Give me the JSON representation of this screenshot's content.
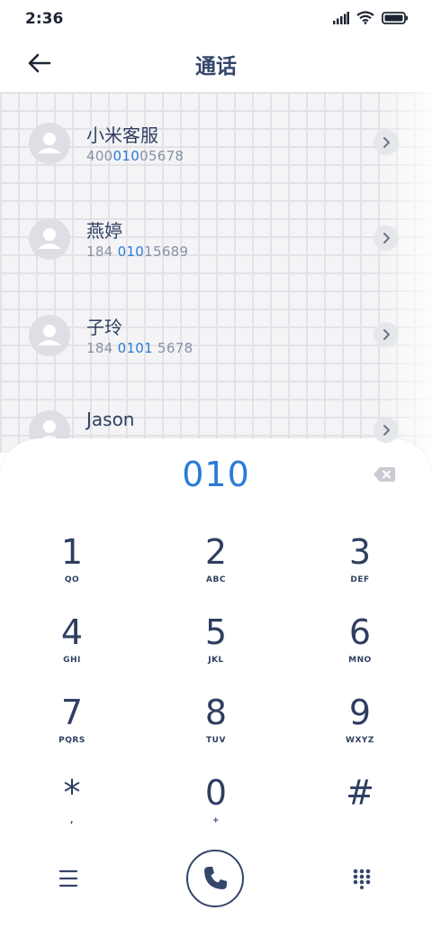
{
  "status_bar": {
    "time": "2:36"
  },
  "header": {
    "title": "通话"
  },
  "contacts": [
    {
      "name": "小米客服",
      "number_parts": [
        "400",
        "010",
        "05678"
      ]
    },
    {
      "name": "燕婷",
      "number_parts": [
        "184 ",
        "010",
        "15689"
      ]
    },
    {
      "name": "子玲",
      "number_parts": [
        "184 ",
        "0101",
        " 5678"
      ]
    },
    {
      "name": "Jason",
      "number_parts": [
        "",
        "",
        ""
      ]
    }
  ],
  "dialer": {
    "input": "010",
    "keys": [
      {
        "digit": "1",
        "letters": "QO"
      },
      {
        "digit": "2",
        "letters": "ABC"
      },
      {
        "digit": "3",
        "letters": "DEF"
      },
      {
        "digit": "4",
        "letters": "GHI"
      },
      {
        "digit": "5",
        "letters": "JKL"
      },
      {
        "digit": "6",
        "letters": "MNO"
      },
      {
        "digit": "7",
        "letters": "PQRS"
      },
      {
        "digit": "8",
        "letters": "TUV"
      },
      {
        "digit": "9",
        "letters": "WXYZ"
      },
      {
        "digit": "*",
        "letters": ","
      },
      {
        "digit": "0",
        "letters": "+"
      },
      {
        "digit": "#",
        "letters": ""
      }
    ]
  },
  "icons": {
    "back": "arrow-left-icon",
    "backspace": "backspace-icon",
    "menu": "menu-icon",
    "call": "phone-icon",
    "keypad": "keypad-icon"
  },
  "colors": {
    "accent": "#2a7bd6",
    "text": "#34456c"
  }
}
